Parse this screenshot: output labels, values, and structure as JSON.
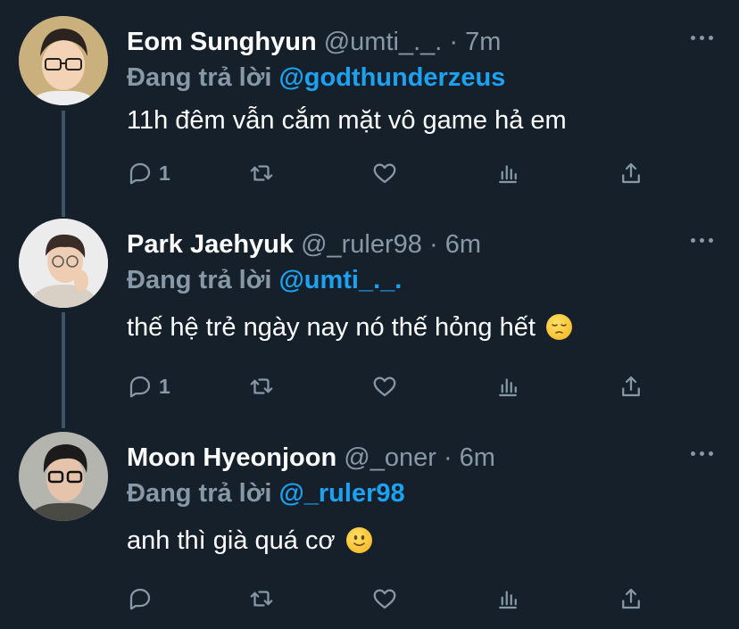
{
  "tweets": [
    {
      "name": "Eom Sunghyun",
      "handle": "@umti_._.",
      "dot": "·",
      "time": "7m",
      "reply_label": "Đang trả lời",
      "reply_to": "@godthunderzeus",
      "text": "11h đêm vẫn cắm mặt vô game hả em",
      "reply_count": "1"
    },
    {
      "name": "Park Jaehyuk",
      "handle": "@_ruler98",
      "dot": "·",
      "time": "6m",
      "reply_label": "Đang trả lời",
      "reply_to": "@umti_._.",
      "text": "thế hệ trẻ ngày nay nó thế hỏng hết",
      "reply_count": "1"
    },
    {
      "name": "Moon Hyeonjoon",
      "handle": "@_oner",
      "dot": "·",
      "time": "6m",
      "reply_label": "Đang trả lời",
      "reply_to": "@_ruler98",
      "text": "anh thì già quá cơ",
      "reply_count": ""
    }
  ],
  "icons": {
    "reply": "reply-icon",
    "retweet": "retweet-icon",
    "like": "heart-icon",
    "analytics": "analytics-icon",
    "share": "share-icon",
    "more": "more-icon"
  },
  "emojis": [
    "pensive-emoji",
    "slightly-smiling-emoji"
  ],
  "colors": {
    "background": "#15202b",
    "secondary_text": "#8899a6",
    "accent": "#1da1f2",
    "thread_line": "#3d5466"
  }
}
